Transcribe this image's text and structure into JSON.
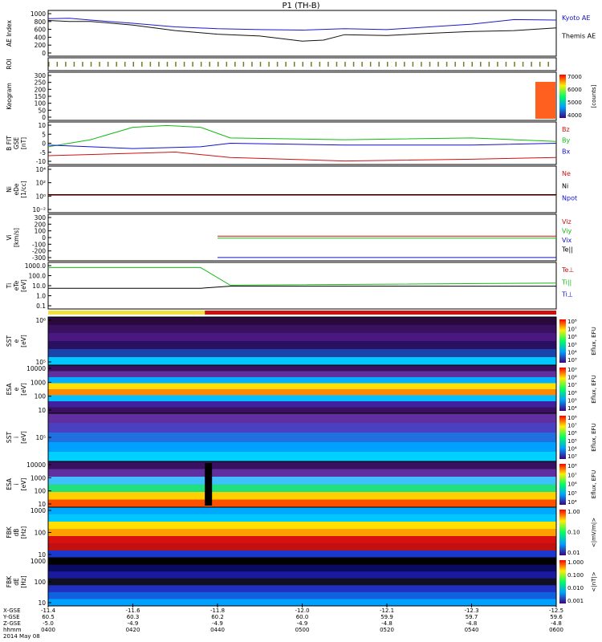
{
  "title": "P1 (TH-B)",
  "colors": {
    "kyoto": "#1a1acc",
    "themis": "#111111",
    "red": "#cc1111",
    "green": "#11bb11",
    "blue": "#1111cc",
    "black": "#000000"
  },
  "panels": [
    {
      "id": "ae",
      "ylabel": [
        "AE Index"
      ],
      "yticks": [
        "1000",
        "800",
        "600",
        "400",
        "200",
        "0"
      ],
      "legend": [
        {
          "text": "Kyoto AE",
          "color": "blue"
        },
        {
          "text": "Themis AE",
          "color": "black"
        }
      ]
    },
    {
      "id": "roi",
      "ylabel": [
        "ROI"
      ],
      "yticks": [],
      "legend": []
    },
    {
      "id": "keogram",
      "ylabel": [
        "Keogram"
      ],
      "yticks": [
        "300",
        "250",
        "200",
        "150",
        "100",
        "50",
        "0"
      ],
      "legend": [],
      "colorbar": {
        "ticks": [
          "7000",
          "6000",
          "5000",
          "4000"
        ],
        "label": "[counts]"
      }
    },
    {
      "id": "bfield",
      "ylabel": [
        "B FIT",
        "GSE",
        "[nT]"
      ],
      "yticks": [
        "10",
        "5",
        "0",
        "-5",
        "-10"
      ],
      "legend": [
        {
          "text": "Bz",
          "color": "red"
        },
        {
          "text": "By",
          "color": "green"
        },
        {
          "text": "Bx",
          "color": "blue"
        }
      ]
    },
    {
      "id": "density",
      "ylabel": [
        "Ni",
        "eDe",
        "[1/cc]"
      ],
      "yticks": [
        "10⁴",
        "10²",
        "10⁰",
        "10⁻²"
      ],
      "legend": [
        {
          "text": "Ne",
          "color": "red"
        },
        {
          "text": "Ni",
          "color": "black"
        },
        {
          "text": "Npot",
          "color": "blue"
        }
      ]
    },
    {
      "id": "velocity",
      "ylabel": [
        "Vi",
        "[km/s]"
      ],
      "yticks": [
        "300",
        "200",
        "100",
        "0",
        "-100",
        "-200",
        "-300"
      ],
      "legend": [
        {
          "text": "Viz",
          "color": "red"
        },
        {
          "text": "Viy",
          "color": "green"
        },
        {
          "text": "Vix",
          "color": "blue"
        },
        {
          "text": "Te||",
          "color": "black"
        }
      ]
    },
    {
      "id": "temperature",
      "ylabel": [
        "Ti",
        "eTe",
        "[eV]"
      ],
      "yticks": [
        "1000.0",
        "100.0",
        "10.0",
        "1.0",
        "0.1"
      ],
      "legend": [
        {
          "text": "Te⊥",
          "color": "red"
        },
        {
          "text": "Ti||",
          "color": "green"
        },
        {
          "text": "Ti⊥",
          "color": "blue"
        }
      ]
    },
    {
      "id": "sst_e",
      "ylabel": [
        "SST",
        "e",
        "[eV]"
      ],
      "yticks": [
        "10⁶",
        "10⁵"
      ],
      "legend": [],
      "colorbar": {
        "ticks": [
          "10⁸",
          "10⁷",
          "10⁶",
          "10⁵",
          "10⁴",
          "10³"
        ],
        "label": "Eflux, EFU"
      }
    },
    {
      "id": "esa_e",
      "ylabel": [
        "ESA",
        "e",
        "[eV]"
      ],
      "yticks": [
        "10000",
        "1000",
        "100",
        "10"
      ],
      "legend": [],
      "colorbar": {
        "ticks": [
          "10⁹",
          "10⁸",
          "10⁷",
          "10⁶",
          "10⁵",
          "10⁴"
        ],
        "label": "Eflux, EFU"
      }
    },
    {
      "id": "sst_i",
      "ylabel": [
        "SST",
        "i",
        "[eV]"
      ],
      "yticks": [
        "10⁵"
      ],
      "legend": [],
      "colorbar": {
        "ticks": [
          "10⁸",
          "10⁷",
          "10⁶",
          "10⁵",
          "10⁴",
          "10³"
        ],
        "label": "Eflux, EFU"
      }
    },
    {
      "id": "esa_i",
      "ylabel": [
        "ESA",
        "i",
        "[eV]"
      ],
      "yticks": [
        "10000",
        "1000",
        "100",
        "10"
      ],
      "legend": [],
      "colorbar": {
        "ticks": [
          "10⁸",
          "10⁷",
          "10⁶",
          "10⁵",
          "10⁴"
        ],
        "label": "Eflux, EFU"
      }
    },
    {
      "id": "fbk_b",
      "ylabel": [
        "FBK",
        "dB",
        "[Hz]"
      ],
      "yticks": [
        "1000",
        "100",
        "10"
      ],
      "legend": [],
      "colorbar": {
        "ticks": [
          "1.00",
          "0.10",
          "0.01"
        ],
        "label": "<|mV/m|>"
      }
    },
    {
      "id": "fbk_e",
      "ylabel": [
        "FBK",
        "dE",
        "[Hz]"
      ],
      "yticks": [
        "1000",
        "100",
        "10"
      ],
      "legend": [],
      "colorbar": {
        "ticks": [
          "1.000",
          "0.100",
          "0.010",
          "0.001"
        ],
        "label": "<|nT|>"
      }
    }
  ],
  "chart_data": {
    "type": "line",
    "time_ticks": [
      "0400",
      "0420",
      "0440",
      "0500",
      "0520",
      "0540",
      "0600"
    ],
    "x_ephemeris": {
      "row_labels": [
        "X-GSE",
        "Y-GSE",
        "Z-GSE",
        "hhmm"
      ],
      "X": [
        "-11.4",
        "-11.6",
        "-11.8",
        "-12.0",
        "-12.1",
        "-12.3",
        "-12.5"
      ],
      "Y": [
        "60.5",
        "60.3",
        "60.2",
        "60.0",
        "59.9",
        "59.7",
        "59.6"
      ],
      "Z": [
        "-5.0",
        "-4.9",
        "-4.9",
        "-4.9",
        "-4.8",
        "-4.8",
        "-4.8"
      ]
    },
    "date": "2014 May 08",
    "series": [
      {
        "name": "Kyoto AE",
        "panel": "ae",
        "x": [
          0,
          5,
          10,
          20,
          30,
          40,
          50,
          60,
          70,
          80,
          90,
          100,
          110,
          120
        ],
        "y": [
          820,
          830,
          790,
          720,
          640,
          600,
          580,
          570,
          600,
          580,
          640,
          700,
          800,
          790
        ]
      },
      {
        "name": "Themis AE",
        "panel": "ae",
        "x": [
          0,
          5,
          10,
          20,
          30,
          40,
          50,
          60,
          65,
          70,
          80,
          90,
          100,
          110,
          120
        ],
        "y": [
          780,
          760,
          760,
          680,
          560,
          480,
          440,
          330,
          350,
          470,
          450,
          500,
          540,
          560,
          620
        ]
      }
    ]
  }
}
